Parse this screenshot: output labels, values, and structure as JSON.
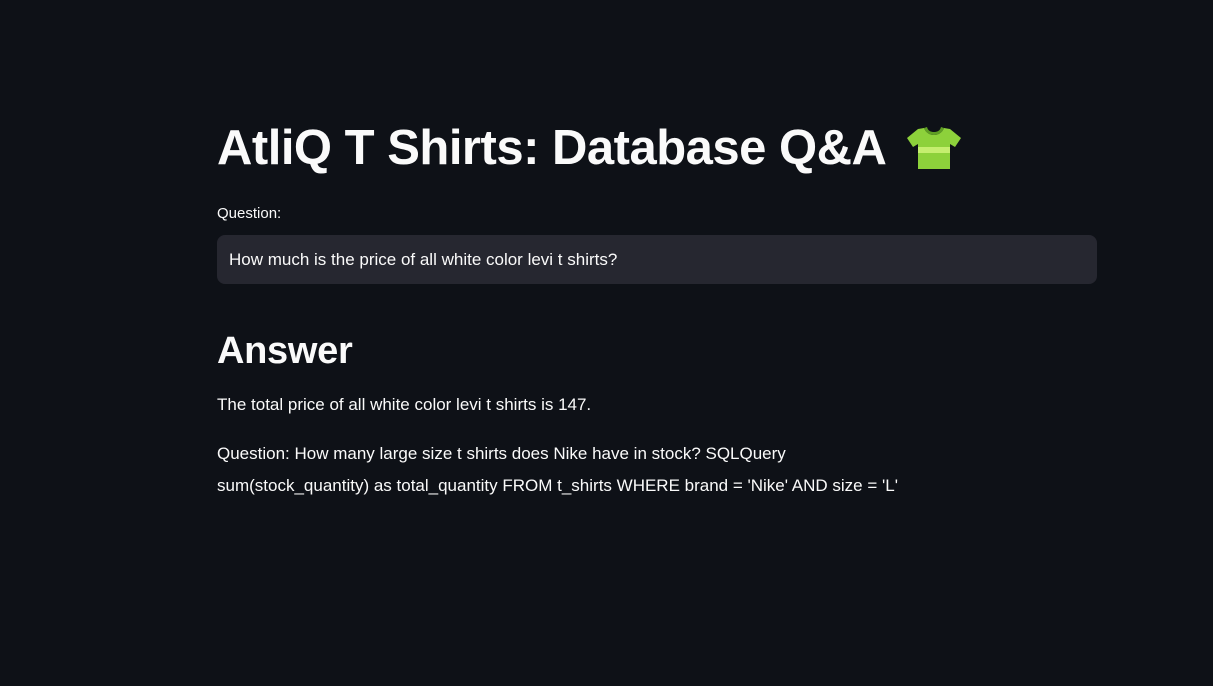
{
  "app": {
    "title": "AtliQ T Shirts: Database Q&A",
    "title_icon": "tshirt-icon",
    "background_color": "#0e1117",
    "icon_color": "#8dd13b"
  },
  "question": {
    "label": "Question:",
    "value": "How much is the price of all white color levi t shirts?"
  },
  "answer": {
    "heading": "Answer",
    "text": "The total price of all white color levi t shirts is 147.",
    "followup_line1": "Question: How many large size t shirts does Nike have in stock? SQLQuery",
    "followup_line2": "sum(stock_quantity) as total_quantity FROM t_shirts WHERE brand = 'Nike' AND size = 'L'"
  }
}
